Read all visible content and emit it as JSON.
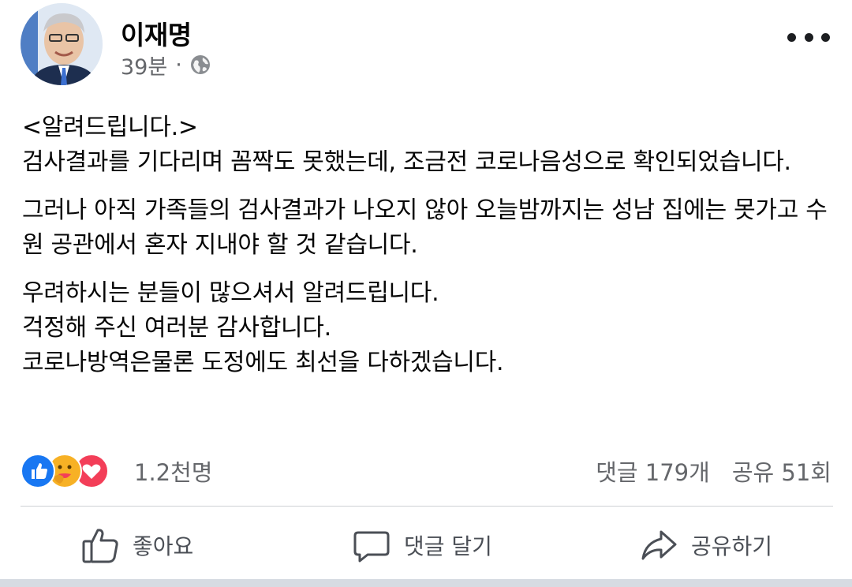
{
  "post": {
    "author": "이재명",
    "time": "39분",
    "separator": "·",
    "privacy_icon": "globe-icon",
    "more_icon": "more-icon",
    "paragraphs": [
      "<알려드립니다.>\n검사결과를 기다리며 꼼짝도 못했는데, 조금전 코로나음성으로 확인되었습니다.",
      "그러나 아직 가족들의 검사결과가 나오지 않아 오늘밤까지는 성남 집에는 못가고 수원 공관에서 혼자 지내야 할 것 같습니다.",
      "우려하시는 분들이 많으셔서 알려드립니다.\n걱정해 주신 여러분 감사합니다.\n코로나방역은물론 도정에도 최선을 다하겠습니다."
    ]
  },
  "stats": {
    "reactions": [
      "like-icon",
      "care-icon",
      "love-icon"
    ],
    "reaction_count": "1.2천명",
    "comments": "댓글 179개",
    "shares": "공유 51회"
  },
  "actions": {
    "like": "좋아요",
    "comment": "댓글 달기",
    "share": "공유하기"
  },
  "colors": {
    "like_blue": "#1877f2",
    "love_red": "#f33e58",
    "care_yellow": "#f7b125",
    "secondary_text": "#65676b"
  }
}
